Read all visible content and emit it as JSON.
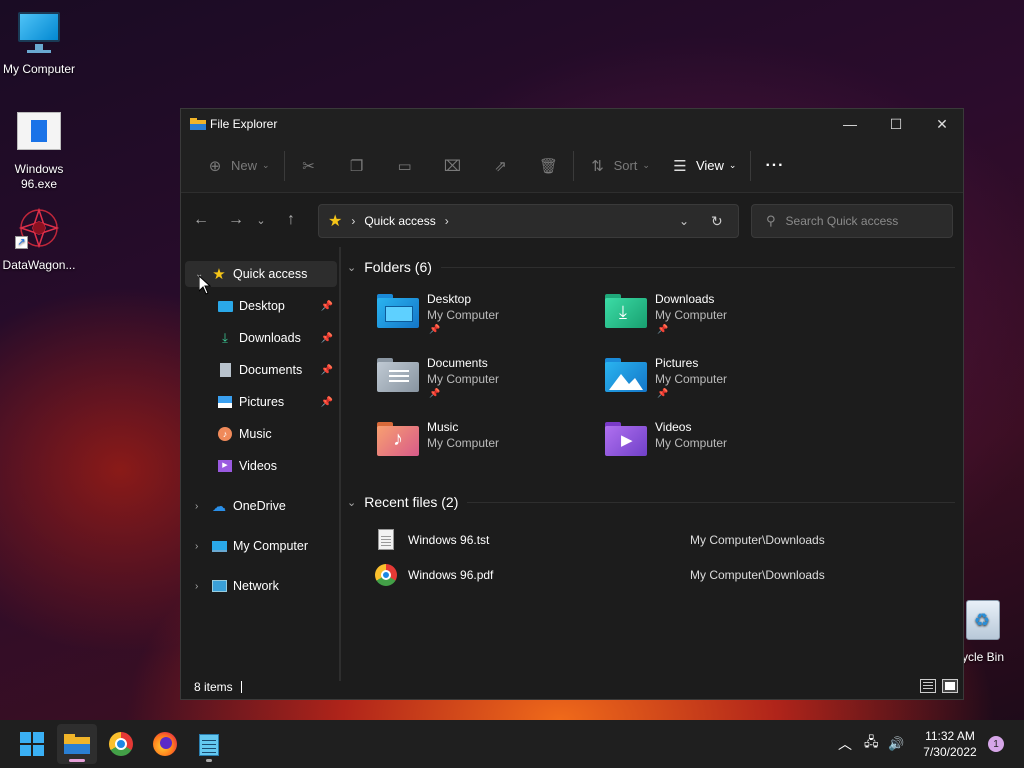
{
  "desktop": {
    "icons": [
      {
        "label": "My Computer"
      },
      {
        "label": "Windows 96.exe"
      },
      {
        "label": "DataWagon..."
      },
      {
        "label": "ycle Bin"
      }
    ]
  },
  "window": {
    "title": "File Explorer",
    "controls": {
      "minimize": "—",
      "maximize": "☐",
      "close": "✕"
    },
    "cmdbar": {
      "new_label": "New",
      "sort_label": "Sort",
      "view_label": "View",
      "more_label": "···"
    },
    "address": {
      "crumb": "Quick access"
    },
    "search": {
      "placeholder": "Search Quick access"
    },
    "sidebar": {
      "items": [
        {
          "label": "Quick access"
        },
        {
          "label": "Desktop"
        },
        {
          "label": "Downloads"
        },
        {
          "label": "Documents"
        },
        {
          "label": "Pictures"
        },
        {
          "label": "Music"
        },
        {
          "label": "Videos"
        },
        {
          "label": "OneDrive"
        },
        {
          "label": "My Computer"
        },
        {
          "label": "Network"
        }
      ]
    },
    "folders_header": "Folders (6)",
    "folders": [
      {
        "name": "Desktop",
        "location": "My Computer",
        "pinned": true
      },
      {
        "name": "Downloads",
        "location": "My Computer",
        "pinned": true
      },
      {
        "name": "Documents",
        "location": "My Computer",
        "pinned": true
      },
      {
        "name": "Pictures",
        "location": "My Computer",
        "pinned": true
      },
      {
        "name": "Music",
        "location": "My Computer",
        "pinned": false
      },
      {
        "name": "Videos",
        "location": "My Computer",
        "pinned": false
      }
    ],
    "recent_header": "Recent files (2)",
    "recent": [
      {
        "name": "Windows 96.tst",
        "location": "My Computer\\Downloads"
      },
      {
        "name": "Windows 96.pdf",
        "location": "My Computer\\Downloads"
      }
    ],
    "status": {
      "items": "8 items"
    }
  },
  "taskbar": {
    "clock_time": "11:32 AM",
    "clock_date": "7/30/2022",
    "notification_count": "1"
  },
  "colors": {
    "accent_star": "#f5c518",
    "active_indicator": "#e6a0d8"
  }
}
